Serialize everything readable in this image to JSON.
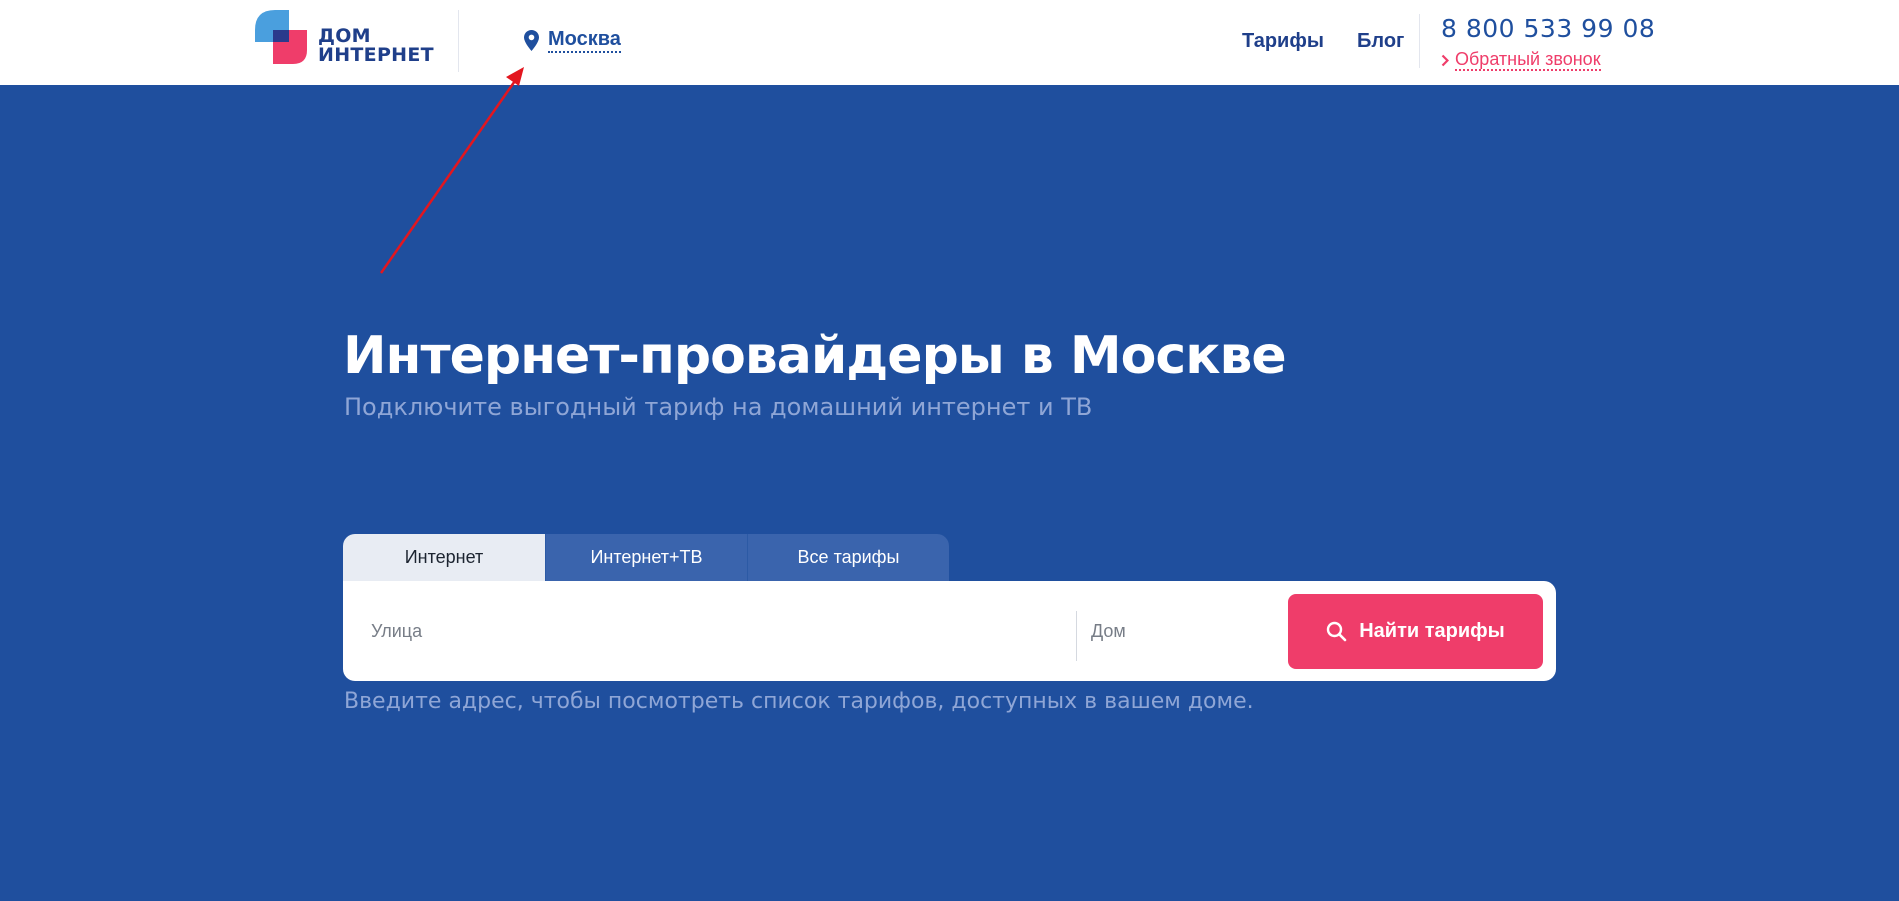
{
  "header": {
    "logo": {
      "line1": "ДОМ",
      "line2": "ИНТЕРНЕТ"
    },
    "city": "Москва",
    "nav": [
      {
        "label": "Тарифы"
      },
      {
        "label": "Блог"
      }
    ],
    "phone": "8 800 533 99 08",
    "callback": "Обратный звонок"
  },
  "hero": {
    "title": "Интернет-провайдеры в Москве",
    "subtitle": "Подключите выгодный тариф на домашний интернет и ТВ"
  },
  "search": {
    "tabs": [
      {
        "label": "Интернет",
        "active": true
      },
      {
        "label": "Интернет+ТВ",
        "active": false
      },
      {
        "label": "Все тарифы",
        "active": false
      }
    ],
    "street_placeholder": "Улица",
    "house_placeholder": "Дом",
    "button_label": "Найти тарифы",
    "hint": "Введите адрес, чтобы посмотреть список тарифов, доступных в вашем доме."
  },
  "colors": {
    "brand_blue": "#1f4f9e",
    "accent_pink": "#ef3d6a",
    "annotation_red": "#e3161f"
  },
  "icons": [
    "logo-mark",
    "location-pin-icon",
    "chevron-right-icon",
    "search-icon"
  ]
}
